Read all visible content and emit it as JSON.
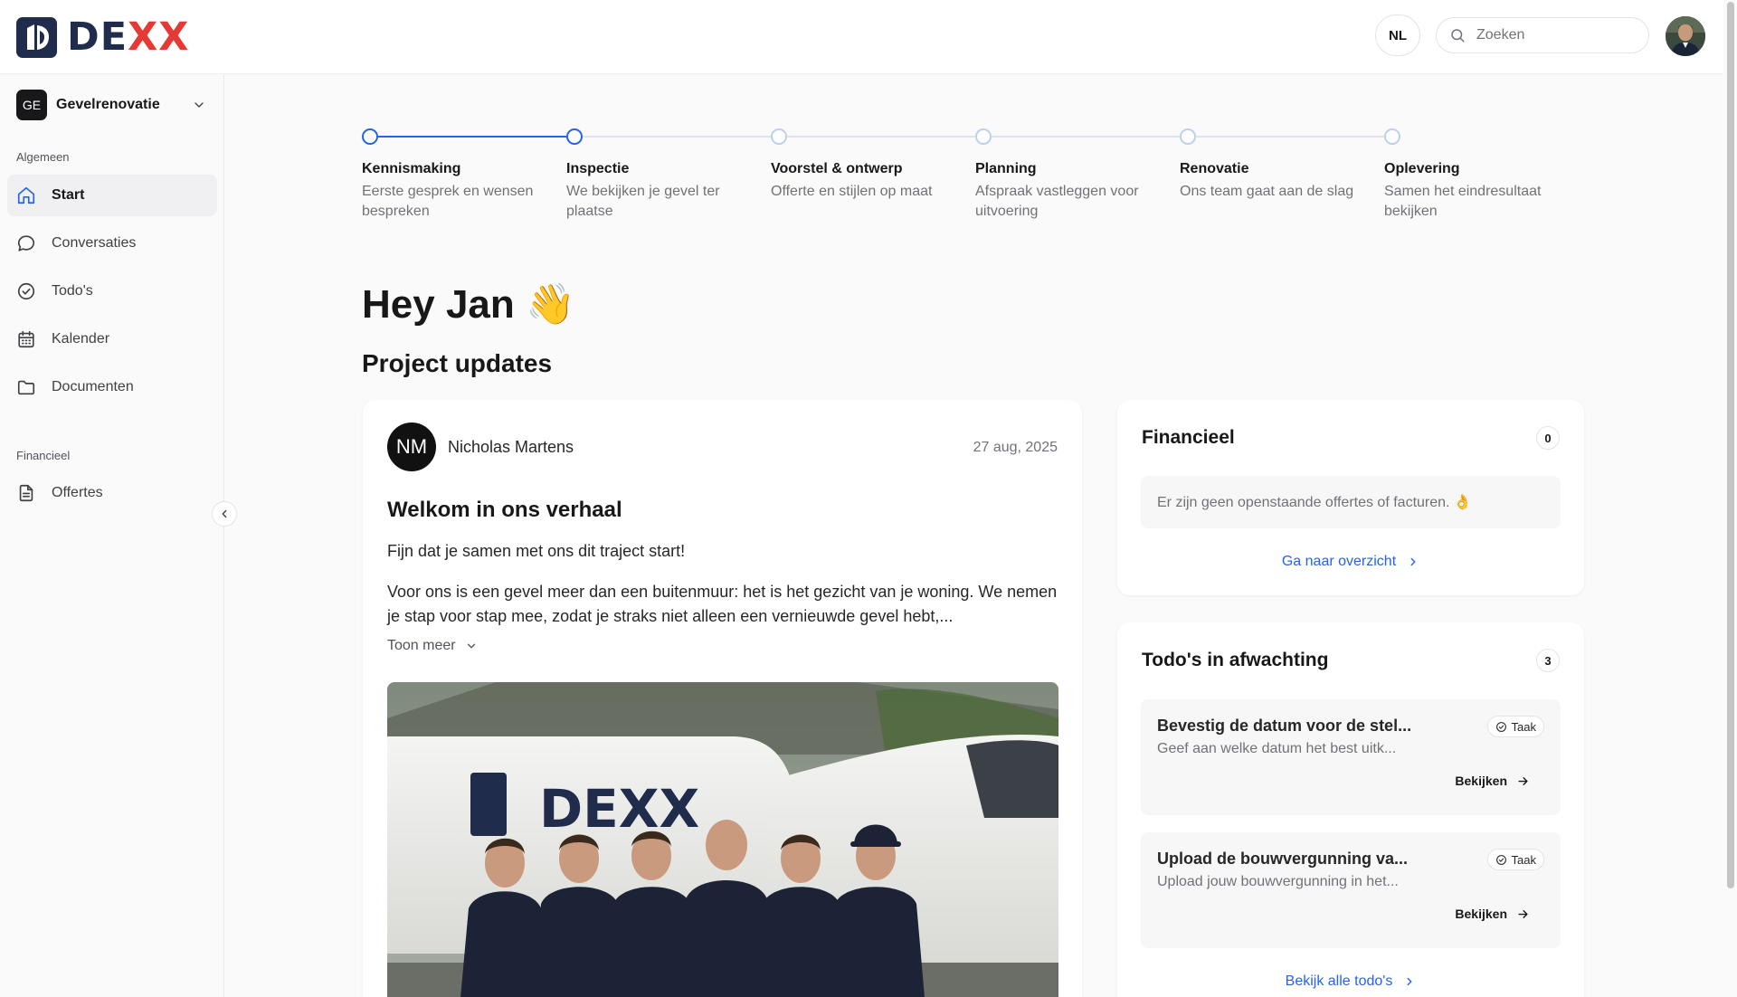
{
  "brand": {
    "name_prefix": "DE",
    "name_accent": "XX"
  },
  "header": {
    "language": "NL",
    "search_placeholder": "Zoeken"
  },
  "sidebar": {
    "project": {
      "badge": "GE",
      "name": "Gevelrenovatie"
    },
    "sections": [
      {
        "label": "Algemeen"
      },
      {
        "label": "Financieel"
      }
    ],
    "items": [
      {
        "label": "Start",
        "icon": "home-icon",
        "active": true
      },
      {
        "label": "Conversaties",
        "icon": "chat-icon"
      },
      {
        "label": "Todo's",
        "icon": "check-circle-icon"
      },
      {
        "label": "Kalender",
        "icon": "calendar-icon"
      },
      {
        "label": "Documenten",
        "icon": "folder-icon"
      },
      {
        "label": "Offertes",
        "icon": "document-icon"
      }
    ]
  },
  "stepper": {
    "steps": [
      {
        "title": "Kennismaking",
        "desc": "Eerste gesprek en wensen bespreken",
        "done": true
      },
      {
        "title": "Inspectie",
        "desc": "We bekijken je gevel ter plaatse",
        "done": true
      },
      {
        "title": "Voorstel & ontwerp",
        "desc": "Offerte en stijlen op maat",
        "done": false
      },
      {
        "title": "Planning",
        "desc": "Afspraak vastleggen voor uitvoering",
        "done": false
      },
      {
        "title": "Renovatie",
        "desc": "Ons team gaat aan de slag",
        "done": false
      },
      {
        "title": "Oplevering",
        "desc": "Samen het eindresultaat bekijken",
        "done": false
      }
    ]
  },
  "main": {
    "greeting": "Hey Jan",
    "greeting_emoji": "👋",
    "updates_title": "Project updates",
    "post": {
      "author_initials": "NM",
      "author_name": "Nicholas Martens",
      "date": "27 aug, 2025",
      "title": "Welkom in ons verhaal",
      "paragraph_1": "Fijn dat je samen met ons dit traject start!",
      "paragraph_2": "Voor ons is een gevel meer dan een buitenmuur: het is het gezicht van je woning. We nemen je stap voor stap mee, zodat je straks niet alleen een vernieuwde gevel hebt,...",
      "show_more": "Toon meer",
      "image_van_text": "DEXX"
    }
  },
  "finance_card": {
    "title": "Financieel",
    "count": "0",
    "empty_text": "Er zijn geen openstaande offertes of facturen. 👌",
    "link": "Ga naar overzicht"
  },
  "todos_card": {
    "title": "Todo's in afwachting",
    "count": "3",
    "items": [
      {
        "title": "Bevestig de datum voor de stel...",
        "desc": "Geef aan welke datum het best uitk...",
        "tag": "Taak",
        "action": "Bekijken"
      },
      {
        "title": "Upload de bouwvergunning va...",
        "desc": "Upload jouw bouwvergunning in het...",
        "tag": "Taak",
        "action": "Bekijken"
      }
    ],
    "link": "Bekijk alle todo's"
  },
  "colors": {
    "accent": "#2563eb",
    "brand_navy": "#1f2c4c",
    "brand_red": "#e53935",
    "step_inactive": "#bcd0ec"
  }
}
